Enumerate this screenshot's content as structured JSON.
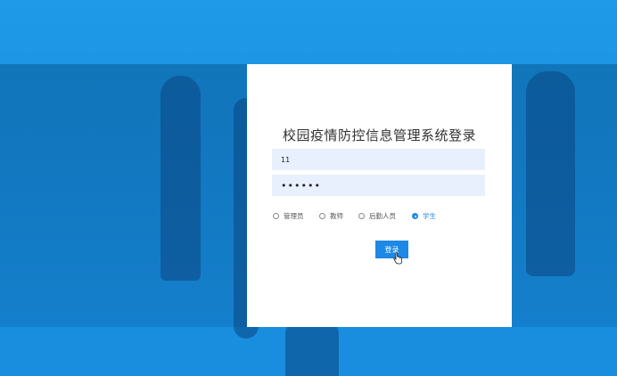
{
  "login": {
    "title": "校园疫情防控信息管理系统登录",
    "username_value": "11",
    "password_value": "••••••",
    "roles": [
      {
        "label": "管理员",
        "checked": false
      },
      {
        "label": "教师",
        "checked": false
      },
      {
        "label": "后勤人员",
        "checked": false
      },
      {
        "label": "学生",
        "checked": true
      }
    ],
    "submit_label": "登录"
  },
  "colors": {
    "accent": "#1e88e5",
    "input_background": "#e8f0fe",
    "page_background": "#1e9ae8"
  },
  "icons": [
    "hand-pointer-cursor-icon"
  ]
}
